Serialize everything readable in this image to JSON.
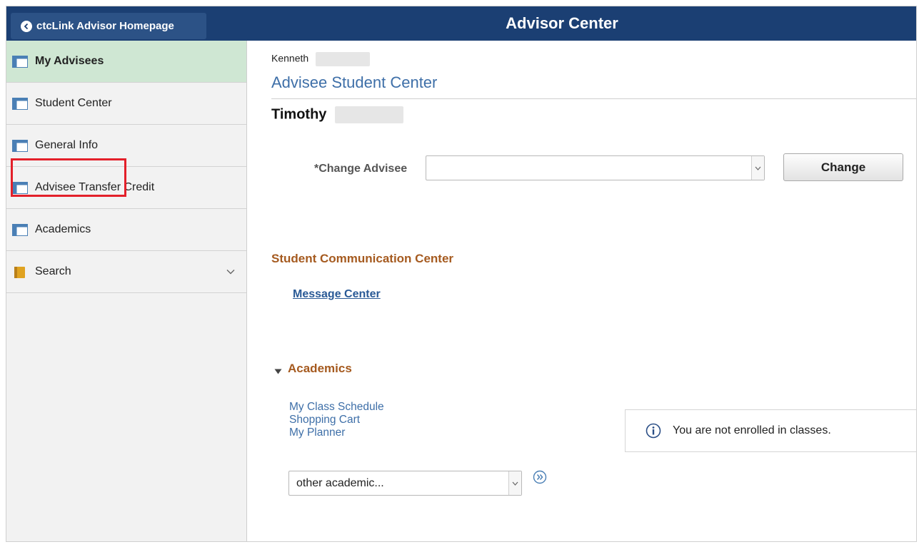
{
  "header": {
    "back_button_label": "ctcLink Advisor Homepage",
    "title": "Advisor Center"
  },
  "sidebar": {
    "items": [
      {
        "label": "My Advisees",
        "icon": "list-panel-icon",
        "active": true
      },
      {
        "label": "Student Center",
        "icon": "list-panel-icon"
      },
      {
        "label": "General Info",
        "icon": "list-panel-icon",
        "highlighted": true
      },
      {
        "label": "Advisee Transfer Credit",
        "icon": "list-panel-icon"
      },
      {
        "label": "Academics",
        "icon": "list-panel-icon"
      },
      {
        "label": "Search",
        "icon": "folder-icon",
        "expandable": true
      }
    ]
  },
  "main": {
    "user_first_name": "Kenneth",
    "page_heading": "Advisee Student Center",
    "student_first_name": "Timothy",
    "change_advisee": {
      "label": "*Change Advisee",
      "selected_value": "",
      "button_label": "Change"
    },
    "communication": {
      "title": "Student Communication Center",
      "link": "Message Center"
    },
    "academics": {
      "title": "Academics",
      "links": [
        "My Class Schedule",
        "Shopping Cart",
        "My Planner"
      ],
      "notice": "You are not enrolled in classes.",
      "other_select_value": "other academic..."
    }
  },
  "colors": {
    "header_bg": "#1b3f73",
    "active_nav_bg": "#cfe7d3",
    "link_blue": "#3e6fa8",
    "section_orange": "#a55a1f",
    "highlight_red": "#e3202a"
  }
}
